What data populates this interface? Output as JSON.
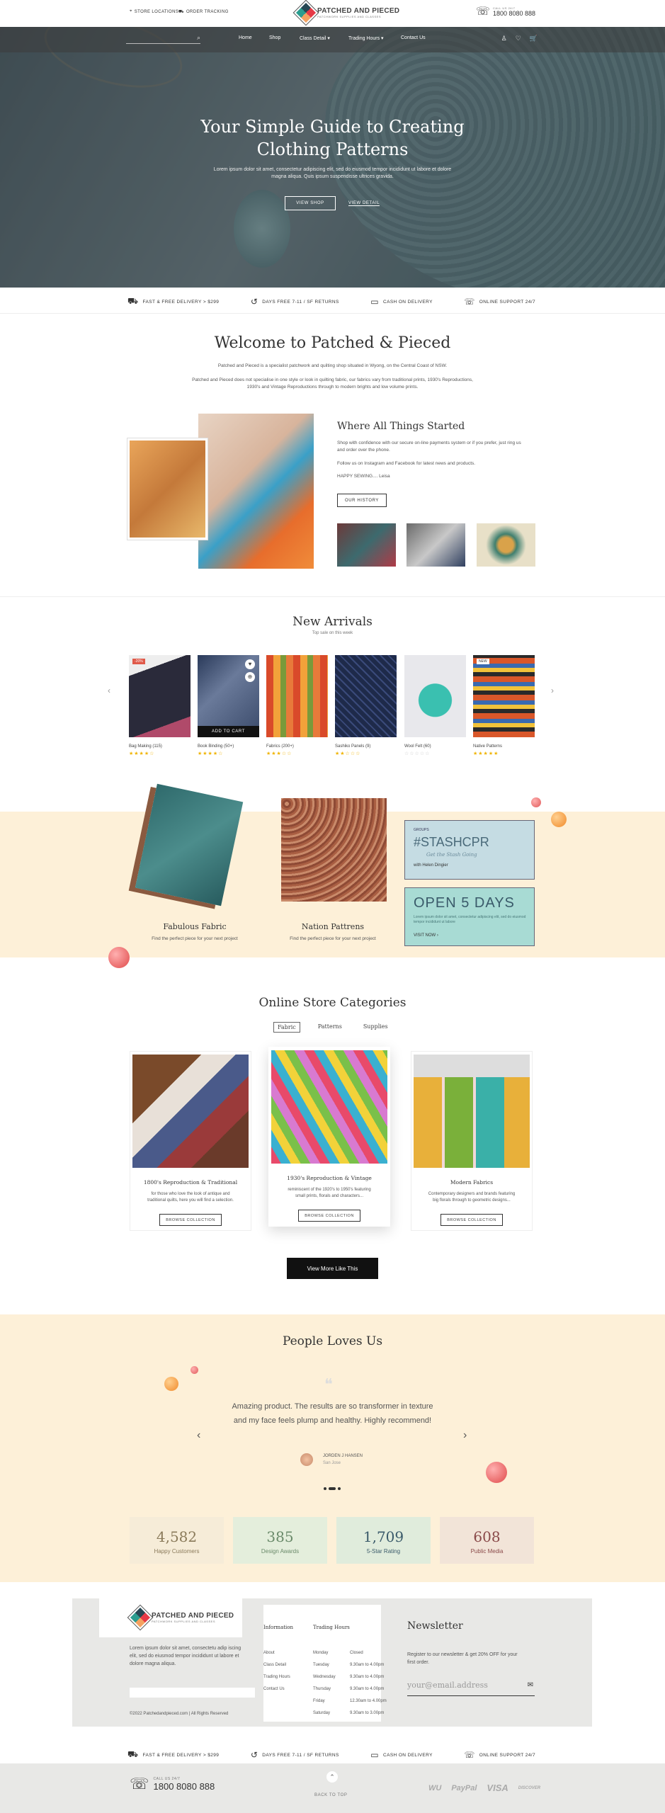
{
  "topbar": {
    "store_locations": "STORE LOCATIONS",
    "order_tracking": "ORDER TRACKING",
    "logo_title": "PATCHED AND PIECED",
    "logo_tagline": "PATCHWORK SUPPLIES AND CLASSES",
    "call_label": "CALL US 24/7",
    "phone": "1800 8080 888"
  },
  "nav": {
    "items": [
      "Home",
      "Shop",
      "Class Detail",
      "Trading Hours",
      "Contact Us"
    ],
    "search_placeholder": "",
    "cart_count": "0",
    "wishlist_count": "0"
  },
  "hero": {
    "title": "Your Simple Guide to Creating Clothing Patterns",
    "subtitle": "Lorem ipsum dolor sit amet, consectetur adipiscing elit, sed do eiusmod tempor incididunt ut labore et dolore magna aliqua. Quis ipsum suspendisse ultrices gravida.",
    "btn_shop": "VIEW SHOP",
    "btn_detail": "VIEW DETAIL"
  },
  "features": [
    {
      "icon": "delivery-icon",
      "label": "FAST & FREE DELIVERY > $299"
    },
    {
      "icon": "returns-icon",
      "label": "DAYS FREE 7-11 / SF RETURNS"
    },
    {
      "icon": "cash-icon",
      "label": "CASH ON DELIVERY"
    },
    {
      "icon": "support-icon",
      "label": "ONLINE SUPPORT 24/7"
    }
  ],
  "welcome": {
    "title": "Welcome to Patched & Pieced",
    "p1": "Patched and Pieced is a specialist patchwork and quilting shop situated in Wyong, on the Central Coast of NSW.",
    "p2": "Patched and Pieced does not specialise in one style or look in quilting fabric, our fabrics vary from traditional prints, 1930's Reproductions, 1930's and Vintage Reproductions through to modern brights and low volume prints."
  },
  "about": {
    "title": "Where All Things Started",
    "p1": "Shop with confidence with our secure on-line payments system or if you prefer, just ring us and order over the phone.",
    "p2": "Follow us on Instagram and Facebook for latest news and products.",
    "p3": "HAPPY SEWING.... Leisa",
    "btn": "OUR HISTORY"
  },
  "new_arrivals": {
    "title": "New Arrivals",
    "subtitle": "Top sale on this week",
    "add_to_cart": "ADD TO CART",
    "products": [
      {
        "name": "Bag Making (115)",
        "badge": "-20%",
        "rating": 4
      },
      {
        "name": "Book Binding (50+)",
        "badge": "",
        "rating": 4
      },
      {
        "name": "Fabrics (200+)",
        "badge": "",
        "rating": 3
      },
      {
        "name": "Sashiko Panels (9)",
        "badge": "",
        "rating": 2
      },
      {
        "name": "Wool Felt (60)",
        "badge": "",
        "rating": 0
      },
      {
        "name": "Native Patterns",
        "badge": "NEW",
        "rating": 5
      }
    ]
  },
  "promo": {
    "fabric_title": "Fabulous Fabric",
    "fabric_sub": "Find the perfect piece for your next project",
    "patterns_title": "Nation Pattrens",
    "patterns_sub": "Find the perfect piece for your next project",
    "card1_small": "GROUPS",
    "card1_tag": "#STASHCPR",
    "card1_script": "Get the Stash Going",
    "card1_sub": "with Helen Dingier",
    "card2_title": "OPEN 5 DAYS",
    "card2_sub": "Lorem ipsum dolor sit amet, consectetur adipiscing elit, sed do eiusmod tempor incididunt ut labore",
    "card2_link": "VISIT NOW"
  },
  "categories": {
    "title": "Online Store Categories",
    "tabs": [
      "Fabric",
      "Patterns",
      "Supplies"
    ],
    "items": [
      {
        "title": "1800's Reproduction & Traditional",
        "sub": "for those who love the look of antique and traditional quilts, here you will find a selection.",
        "btn": "BROWSE COLLECTION"
      },
      {
        "title": "1930's Reproduction & Vintage",
        "sub": "reminiscent of the 1920's to 1950's featuring small prints, florals and characters...",
        "btn": "BROWSE COLLECTION"
      },
      {
        "title": "Modern Fabrics",
        "sub": "Contemporary designers and brands featuring big florals through to geometric designs...",
        "btn": "BROWSE COLLECTION"
      }
    ],
    "more_btn": "View More Like This"
  },
  "testimonials": {
    "title": "People Loves Us",
    "quote": "Amazing product. The results are so transformer in texture and my face feels plump and healthy. Highly recommend!",
    "author": "JORDEN J HANSEN",
    "location": "San Jose"
  },
  "stats": [
    {
      "value": "4,582",
      "label": "Happy Customers",
      "bg": "#f6ecd8",
      "color": "#8a7a5a"
    },
    {
      "value": "385",
      "label": "Design Awards",
      "bg": "#e4eedc",
      "color": "#6a8a6a"
    },
    {
      "value": "1,709",
      "label": "5-Star Rating",
      "bg": "#e0ecdc",
      "color": "#3a5a6a"
    },
    {
      "value": "608",
      "label": "Public Media",
      "bg": "#f2e4d8",
      "color": "#8a4a4a"
    }
  ],
  "footer": {
    "about_text": "Lorem ipsum dolor sit amet, consectetu adip iscing elit, sed do eiusmod tempor incididunt ut labore et dolore magna aliqua.",
    "copyright": "©2022 Patchedandpieced.com  |  All Rights Reserved",
    "info_title": "Information",
    "info_links": [
      "About",
      "Class Detail",
      "Trading Hours",
      "Contact Us"
    ],
    "hours_title": "Trading Hours",
    "hours": [
      {
        "day": "Monday",
        "time": "Closed"
      },
      {
        "day": "Tuesday",
        "time": "9.30am to 4.00pm"
      },
      {
        "day": "Wednesday",
        "time": "9.30am to 4.00pm"
      },
      {
        "day": "Thursday",
        "time": "9.30am to 4.00pm"
      },
      {
        "day": "Friday",
        "time": "12.30am to 4.00pm"
      },
      {
        "day": "Saturday",
        "time": "9.30am to 3.00pm"
      }
    ],
    "newsletter_title": "Newsletter",
    "newsletter_sub": "Register to our newsletter & get 20% OFF for your first order.",
    "email_placeholder": "your@email.address"
  },
  "bottom": {
    "call_label": "CALL US 24/7",
    "phone": "1800 8080 888",
    "back_to_top": "BACK TO TOP",
    "payments": [
      "WU",
      "PayPal",
      "VISA",
      "DISCOVER"
    ]
  }
}
